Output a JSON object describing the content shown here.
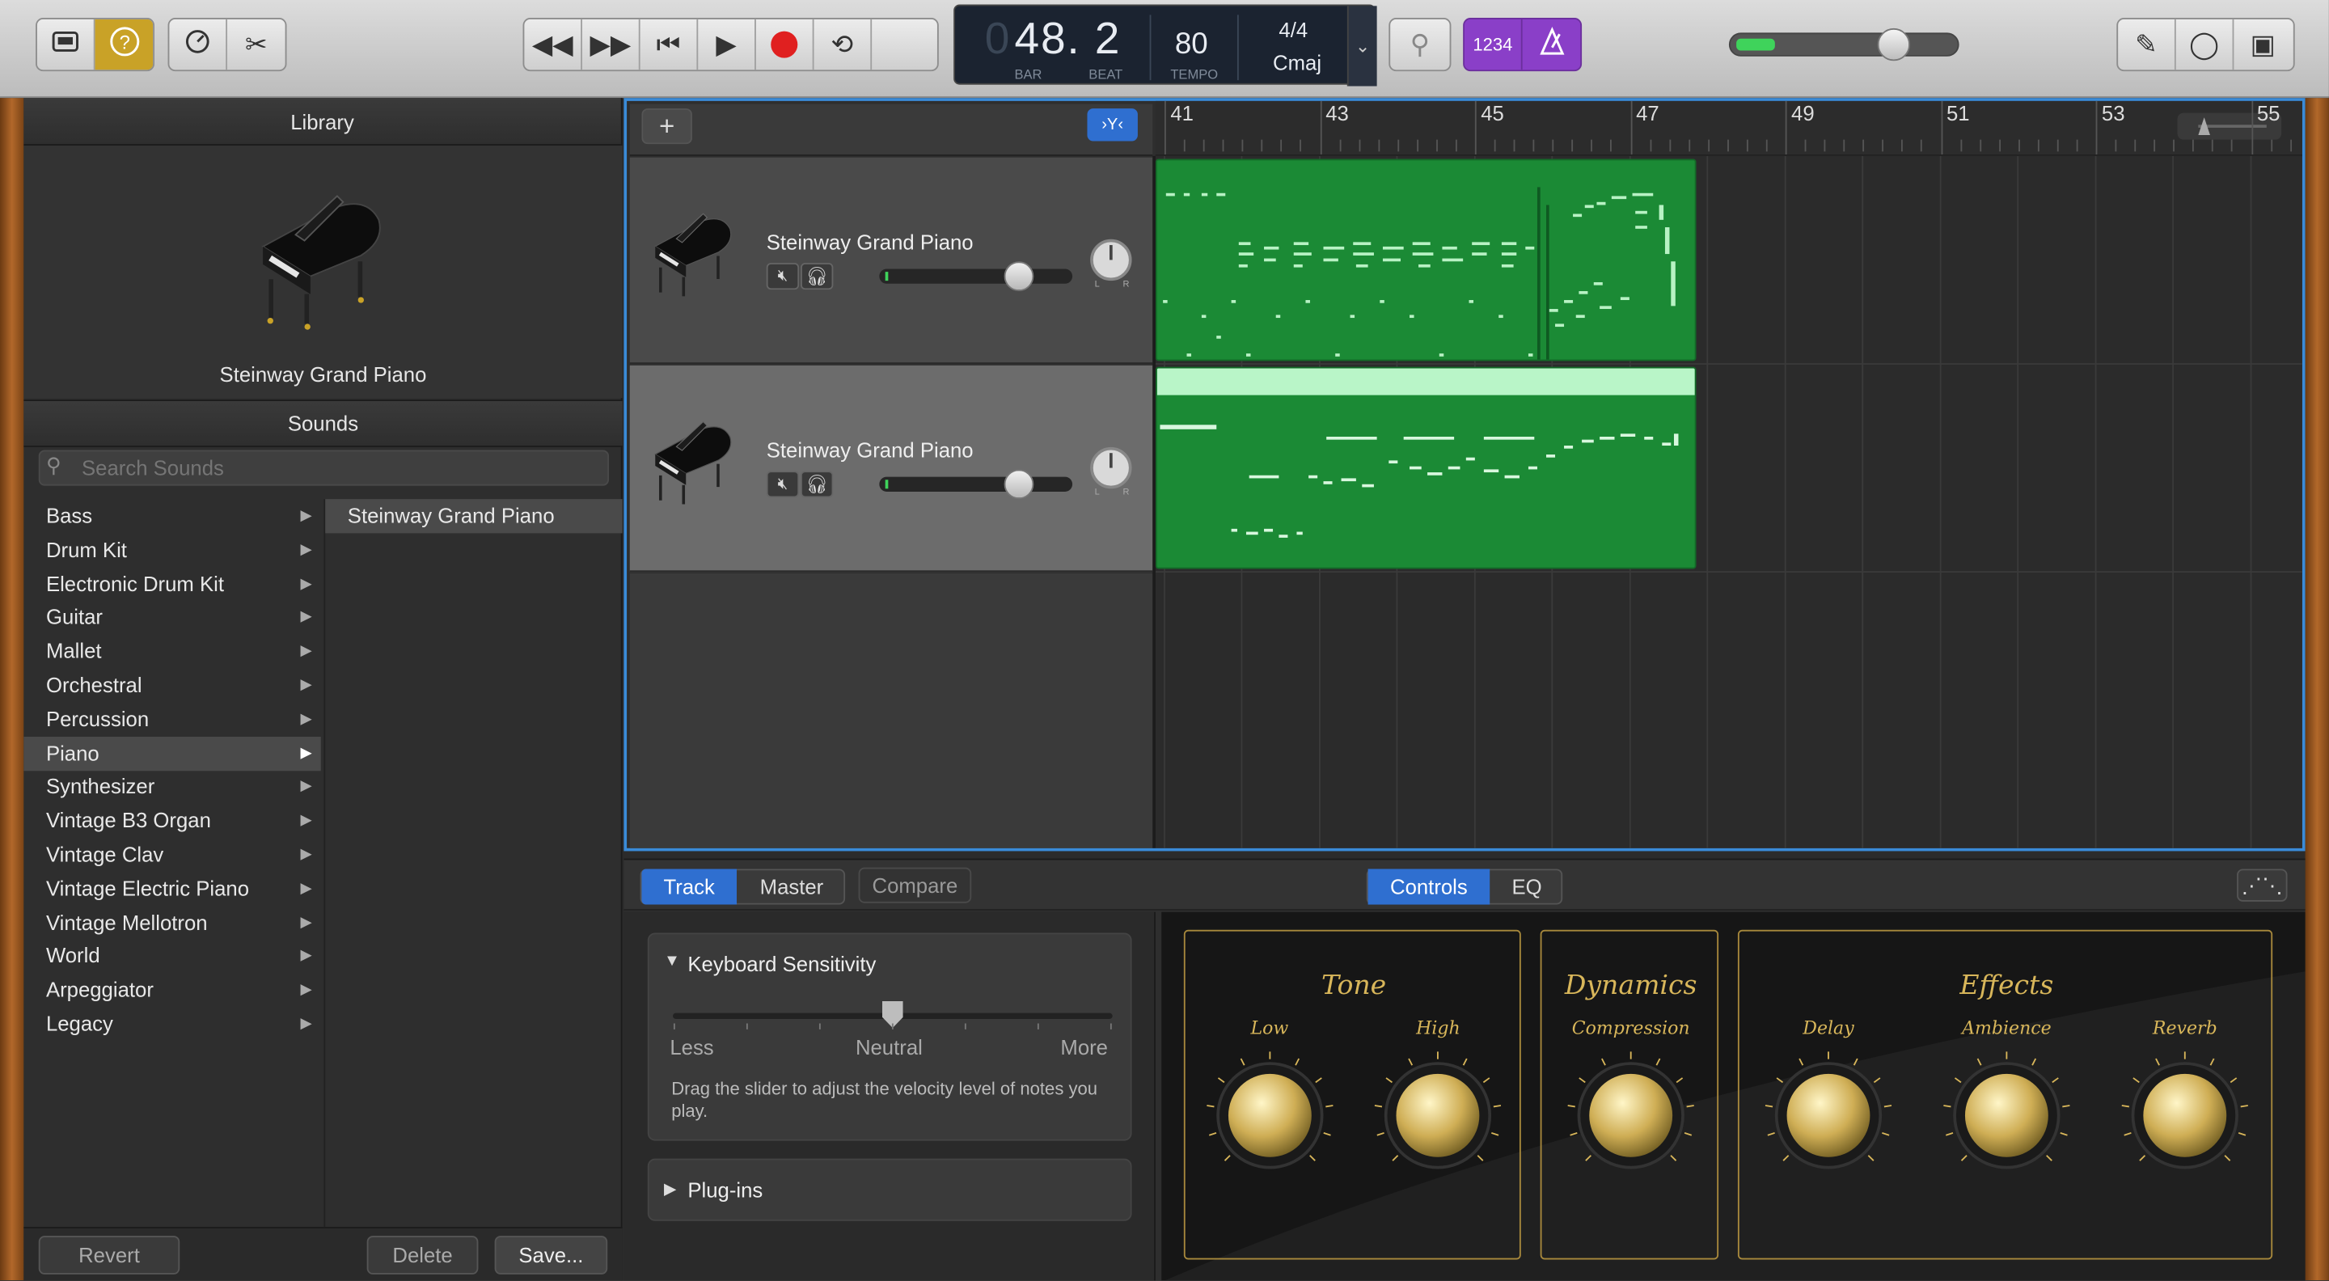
{
  "toolbar": {
    "library_icon": "library-icon",
    "help_icon": "help-icon",
    "smart_controls_icon": "smart-controls-icon",
    "editors_icon": "scissors-icon",
    "rewind_icon": "rewind-icon",
    "forward_icon": "fast-forward-icon",
    "to_start_icon": "go-to-beginning-icon",
    "play_icon": "play-icon",
    "record_icon": "record-icon",
    "cycle_icon": "cycle-icon",
    "tuner_icon": "tuner-icon",
    "count_in_label": "1234",
    "metronome_icon": "metronome-icon",
    "volume_level": 0.75,
    "notepad_icon": "notepad-icon",
    "loops_icon": "loops-icon",
    "media_icon": "media-browser-icon"
  },
  "lcd": {
    "position_prefix": "0",
    "position": "48. 2",
    "bar_label": "BAR",
    "beat_label": "BEAT",
    "tempo": "80",
    "tempo_label": "TEMPO",
    "time_signature": "4/4",
    "key": "Cmaj"
  },
  "library": {
    "title": "Library",
    "instrument_name": "Steinway Grand Piano",
    "sounds_title": "Sounds",
    "search_placeholder": "Search Sounds",
    "categories": [
      "Bass",
      "Drum Kit",
      "Electronic Drum Kit",
      "Guitar",
      "Mallet",
      "Orchestral",
      "Percussion",
      "Piano",
      "Synthesizer",
      "Vintage B3 Organ",
      "Vintage Clav",
      "Vintage Electric Piano",
      "Vintage Mellotron",
      "World",
      "Arpeggiator",
      "Legacy"
    ],
    "selected_category": "Piano",
    "patches": [
      "Steinway Grand Piano"
    ],
    "revert_label": "Revert",
    "delete_label": "Delete",
    "save_label": "Save..."
  },
  "tracks": {
    "add_label": "+",
    "items": [
      {
        "name": "Steinway Grand Piano",
        "volume": 0.72,
        "selected": false
      },
      {
        "name": "Steinway Grand Piano",
        "volume": 0.72,
        "selected": true
      }
    ]
  },
  "ruler": {
    "bars": [
      "41",
      "43",
      "45",
      "47",
      "49",
      "51",
      "53",
      "55"
    ]
  },
  "smart_controls": {
    "tabs": [
      "Track",
      "Master"
    ],
    "active_tab": "Track",
    "compare_label": "Compare",
    "view_tabs": [
      "Controls",
      "EQ"
    ],
    "active_view": "Controls",
    "keyboard_sensitivity": {
      "title": "Keyboard Sensitivity",
      "value": 0.5,
      "less": "Less",
      "neutral": "Neutral",
      "more": "More",
      "help": "Drag the slider to adjust the velocity level of notes you play."
    },
    "plugins_label": "Plug-ins",
    "groups": [
      {
        "title": "Tone",
        "knobs": [
          "Low",
          "High"
        ]
      },
      {
        "title": "Dynamics",
        "knobs": [
          "Compression"
        ]
      },
      {
        "title": "Effects",
        "knobs": [
          "Delay",
          "Ambience",
          "Reverb"
        ]
      }
    ]
  }
}
